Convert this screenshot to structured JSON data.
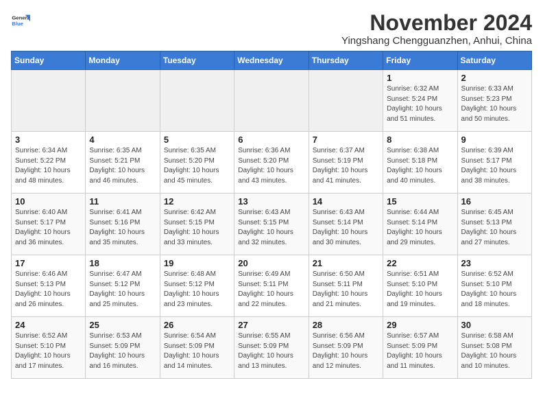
{
  "header": {
    "logo_general": "General",
    "logo_blue": "Blue",
    "title": "November 2024",
    "subtitle": "Yingshang Chengguanzhen, Anhui, China"
  },
  "weekdays": [
    "Sunday",
    "Monday",
    "Tuesday",
    "Wednesday",
    "Thursday",
    "Friday",
    "Saturday"
  ],
  "weeks": [
    [
      {
        "day": "",
        "info": ""
      },
      {
        "day": "",
        "info": ""
      },
      {
        "day": "",
        "info": ""
      },
      {
        "day": "",
        "info": ""
      },
      {
        "day": "",
        "info": ""
      },
      {
        "day": "1",
        "info": "Sunrise: 6:32 AM\nSunset: 5:24 PM\nDaylight: 10 hours and 51 minutes."
      },
      {
        "day": "2",
        "info": "Sunrise: 6:33 AM\nSunset: 5:23 PM\nDaylight: 10 hours and 50 minutes."
      }
    ],
    [
      {
        "day": "3",
        "info": "Sunrise: 6:34 AM\nSunset: 5:22 PM\nDaylight: 10 hours and 48 minutes."
      },
      {
        "day": "4",
        "info": "Sunrise: 6:35 AM\nSunset: 5:21 PM\nDaylight: 10 hours and 46 minutes."
      },
      {
        "day": "5",
        "info": "Sunrise: 6:35 AM\nSunset: 5:20 PM\nDaylight: 10 hours and 45 minutes."
      },
      {
        "day": "6",
        "info": "Sunrise: 6:36 AM\nSunset: 5:20 PM\nDaylight: 10 hours and 43 minutes."
      },
      {
        "day": "7",
        "info": "Sunrise: 6:37 AM\nSunset: 5:19 PM\nDaylight: 10 hours and 41 minutes."
      },
      {
        "day": "8",
        "info": "Sunrise: 6:38 AM\nSunset: 5:18 PM\nDaylight: 10 hours and 40 minutes."
      },
      {
        "day": "9",
        "info": "Sunrise: 6:39 AM\nSunset: 5:17 PM\nDaylight: 10 hours and 38 minutes."
      }
    ],
    [
      {
        "day": "10",
        "info": "Sunrise: 6:40 AM\nSunset: 5:17 PM\nDaylight: 10 hours and 36 minutes."
      },
      {
        "day": "11",
        "info": "Sunrise: 6:41 AM\nSunset: 5:16 PM\nDaylight: 10 hours and 35 minutes."
      },
      {
        "day": "12",
        "info": "Sunrise: 6:42 AM\nSunset: 5:15 PM\nDaylight: 10 hours and 33 minutes."
      },
      {
        "day": "13",
        "info": "Sunrise: 6:43 AM\nSunset: 5:15 PM\nDaylight: 10 hours and 32 minutes."
      },
      {
        "day": "14",
        "info": "Sunrise: 6:43 AM\nSunset: 5:14 PM\nDaylight: 10 hours and 30 minutes."
      },
      {
        "day": "15",
        "info": "Sunrise: 6:44 AM\nSunset: 5:14 PM\nDaylight: 10 hours and 29 minutes."
      },
      {
        "day": "16",
        "info": "Sunrise: 6:45 AM\nSunset: 5:13 PM\nDaylight: 10 hours and 27 minutes."
      }
    ],
    [
      {
        "day": "17",
        "info": "Sunrise: 6:46 AM\nSunset: 5:13 PM\nDaylight: 10 hours and 26 minutes."
      },
      {
        "day": "18",
        "info": "Sunrise: 6:47 AM\nSunset: 5:12 PM\nDaylight: 10 hours and 25 minutes."
      },
      {
        "day": "19",
        "info": "Sunrise: 6:48 AM\nSunset: 5:12 PM\nDaylight: 10 hours and 23 minutes."
      },
      {
        "day": "20",
        "info": "Sunrise: 6:49 AM\nSunset: 5:11 PM\nDaylight: 10 hours and 22 minutes."
      },
      {
        "day": "21",
        "info": "Sunrise: 6:50 AM\nSunset: 5:11 PM\nDaylight: 10 hours and 21 minutes."
      },
      {
        "day": "22",
        "info": "Sunrise: 6:51 AM\nSunset: 5:10 PM\nDaylight: 10 hours and 19 minutes."
      },
      {
        "day": "23",
        "info": "Sunrise: 6:52 AM\nSunset: 5:10 PM\nDaylight: 10 hours and 18 minutes."
      }
    ],
    [
      {
        "day": "24",
        "info": "Sunrise: 6:52 AM\nSunset: 5:10 PM\nDaylight: 10 hours and 17 minutes."
      },
      {
        "day": "25",
        "info": "Sunrise: 6:53 AM\nSunset: 5:09 PM\nDaylight: 10 hours and 16 minutes."
      },
      {
        "day": "26",
        "info": "Sunrise: 6:54 AM\nSunset: 5:09 PM\nDaylight: 10 hours and 14 minutes."
      },
      {
        "day": "27",
        "info": "Sunrise: 6:55 AM\nSunset: 5:09 PM\nDaylight: 10 hours and 13 minutes."
      },
      {
        "day": "28",
        "info": "Sunrise: 6:56 AM\nSunset: 5:09 PM\nDaylight: 10 hours and 12 minutes."
      },
      {
        "day": "29",
        "info": "Sunrise: 6:57 AM\nSunset: 5:09 PM\nDaylight: 10 hours and 11 minutes."
      },
      {
        "day": "30",
        "info": "Sunrise: 6:58 AM\nSunset: 5:08 PM\nDaylight: 10 hours and 10 minutes."
      }
    ]
  ]
}
